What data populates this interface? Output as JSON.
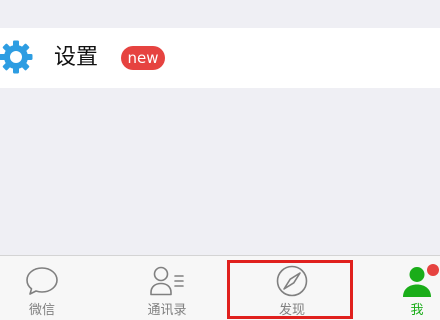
{
  "settings_row": {
    "icon": "gear-icon",
    "label": "设置",
    "badge": "new"
  },
  "tab_bar": {
    "tabs": [
      {
        "label": "微信",
        "icon": "chat-bubble-icon",
        "active": false
      },
      {
        "label": "通讯录",
        "icon": "contacts-icon",
        "active": false
      },
      {
        "label": "发现",
        "icon": "compass-icon",
        "active": false,
        "highlighted": true
      },
      {
        "label": "我",
        "icon": "person-icon",
        "active": true,
        "notification_dot": true
      }
    ]
  },
  "colors": {
    "background": "#EFEFF4",
    "gear_blue": "#2D9DE2",
    "badge_red": "#E64340",
    "active_green": "#1AAD19",
    "inactive_gray": "#808080",
    "highlight_red": "#E0201E"
  }
}
